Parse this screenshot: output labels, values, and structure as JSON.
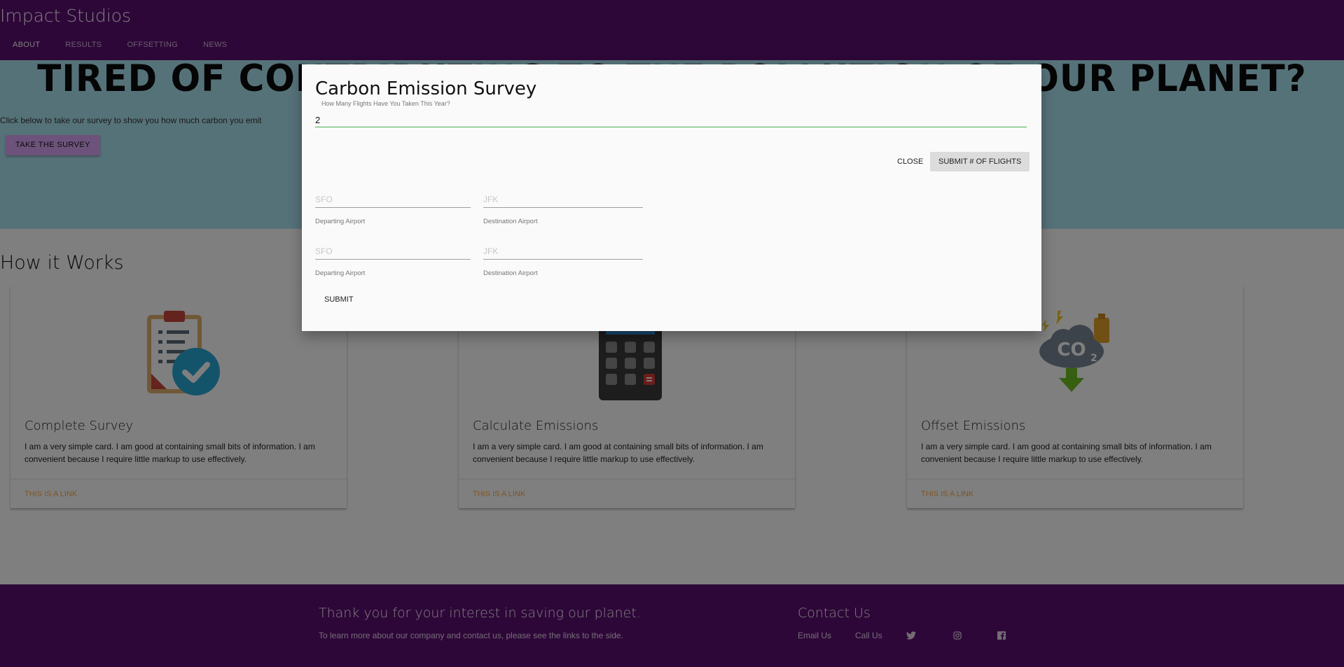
{
  "header": {
    "brand": "Impact Studios",
    "tabs": [
      {
        "label": "ABOUT",
        "active": true
      },
      {
        "label": "RESULTS",
        "active": false
      },
      {
        "label": "OFFSETTING",
        "active": false
      },
      {
        "label": "NEWS",
        "active": false
      }
    ]
  },
  "hero": {
    "title": "TIRED OF CONTRIBUTING TO THE POLLUTION OF OUR PLANET?",
    "text": "Click below to take our survey to show you how much carbon you emit",
    "button_label": "TAKE THE SURVEY"
  },
  "how_it_works": {
    "title": "How it Works",
    "cards": [
      {
        "icon": "clipboard-check-icon",
        "title": "Complete Survey",
        "text": "I am a very simple card. I am good at containing small bits of information. I am convenient because I require little markup to use effectively.",
        "link": "THIS IS A LINK"
      },
      {
        "icon": "calculator-icon",
        "title": "Calculate Emissions",
        "text": "I am a very simple card. I am good at containing small bits of information. I am convenient because I require little markup to use effectively.",
        "link": "THIS IS A LINK"
      },
      {
        "icon": "co2-cloud-icon",
        "title": "Offset Emissions",
        "text": "I am a very simple card. I am good at containing small bits of information. I am convenient because I require little markup to use effectively.",
        "link": "THIS IS A LINK"
      }
    ]
  },
  "modal": {
    "title": "Carbon Emission Survey",
    "flights_label": "How Many Flights Have You Taken This Year?",
    "flights_value": "2",
    "close_label": "CLOSE",
    "submit_count_label": "SUBMIT # OF FLIGHTS",
    "flights": [
      {
        "departing_placeholder": "SFO",
        "departing_label": "Departing Airport",
        "destination_placeholder": "JFK",
        "destination_label": "Destination Airport"
      },
      {
        "departing_placeholder": "SFO",
        "departing_label": "Departing Airport",
        "destination_placeholder": "JFK",
        "destination_label": "Destination Airport"
      }
    ],
    "submit_label": "SUBMIT"
  },
  "footer": {
    "heading": "Thank you for your interest in saving our planet.",
    "text": "To learn more about our company and contact us, please see the links to the side.",
    "contact_heading": "Contact Us",
    "email_label": "Email Us",
    "call_label": "Call Us",
    "social_icons": [
      "twitter-icon",
      "instagram-icon",
      "facebook-icon"
    ]
  },
  "colors": {
    "brand_purple": "#5c0f73",
    "hero_bg": "#ade5f2",
    "survey_button": "#dba6f7",
    "link_orange": "#ffab40",
    "input_focus_green": "#4caf50"
  }
}
